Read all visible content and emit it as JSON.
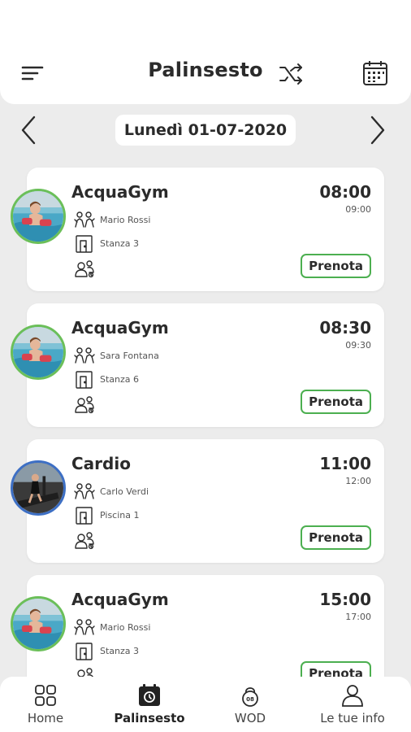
{
  "header": {
    "title": "Palinsesto",
    "menu_icon": "menu-icon",
    "shuffle_icon": "shuffle-icon",
    "calendar_icon": "calendar-icon"
  },
  "date_nav": {
    "date": "Lunedì 01-07-2020",
    "prev_icon": "chevron-left-icon",
    "next_icon": "chevron-right-icon"
  },
  "classes": [
    {
      "name": "AcquaGym",
      "start": "08:00",
      "end": "09:00",
      "instructor": "Mario Rossi",
      "room": "Stanza 3",
      "book_label": "Prenota",
      "avatar": "aquagym-photo"
    },
    {
      "name": "AcquaGym",
      "start": "08:30",
      "end": "09:30",
      "instructor": "Sara Fontana",
      "room": "Stanza 6",
      "book_label": "Prenota",
      "avatar": "aquagym-photo"
    },
    {
      "name": "Cardio",
      "start": "11:00",
      "end": "12:00",
      "instructor": "Carlo Verdi",
      "room": "Piscina 1",
      "book_label": "Prenota",
      "avatar": "cardio-photo"
    },
    {
      "name": "AcquaGym",
      "start": "15:00",
      "end": "17:00",
      "instructor": "Mario Rossi",
      "room": "Stanza 3",
      "book_label": "Prenota",
      "avatar": "aquagym-photo"
    }
  ],
  "tabbar": {
    "tabs": [
      {
        "label": "Home",
        "icon": "grid-icon",
        "active": false
      },
      {
        "label": "Palinsesto",
        "icon": "calendar-clock-icon",
        "active": true
      },
      {
        "label": "WOD",
        "icon": "kettlebell-icon",
        "active": false
      },
      {
        "label": "Le tue info",
        "icon": "user-icon",
        "active": false
      }
    ]
  },
  "colors": {
    "background": "#ececec",
    "accent_green": "#4caf50",
    "avatar_green": "#6bbf59",
    "avatar_blue": "#3d6fc4",
    "text": "#2b2b2b"
  }
}
